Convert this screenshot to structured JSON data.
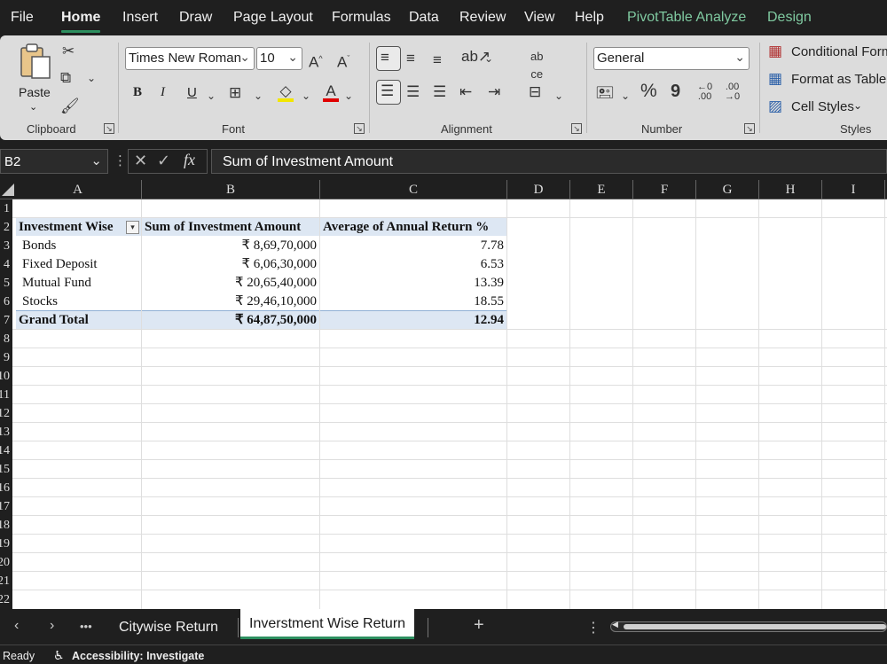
{
  "menu": {
    "items": [
      "File",
      "Home",
      "Insert",
      "Draw",
      "Page Layout",
      "Formulas",
      "Data",
      "Review",
      "View",
      "Help",
      "PivotTable Analyze",
      "Design"
    ],
    "active": "Home"
  },
  "ribbon": {
    "clipboard": {
      "paste_label": "Paste",
      "group_label": "Clipboard"
    },
    "font": {
      "font_name": "Times New Roman",
      "font_size": "10",
      "bold": "B",
      "italic": "I",
      "underline": "U",
      "group_label": "Font"
    },
    "alignment": {
      "group_label": "Alignment"
    },
    "number": {
      "format": "General",
      "percent": "%",
      "comma": "9",
      "group_label": "Number"
    },
    "styles": {
      "conditional_formatting": "Conditional Form",
      "format_as_table": "Format as Table",
      "cell_styles": "Cell Styles",
      "group_label": "Styles"
    }
  },
  "formula_bar": {
    "name_box": "B2",
    "formula": "Sum of  Investment Amount"
  },
  "columns": [
    "A",
    "B",
    "C",
    "D",
    "E",
    "F",
    "G",
    "H",
    "I"
  ],
  "rows": [
    "1",
    "2",
    "3",
    "4",
    "5",
    "6",
    "7",
    "8",
    "9",
    "10",
    "11",
    "12",
    "13",
    "14",
    "15",
    "16",
    "17",
    "18",
    "19",
    "20",
    "21",
    "22"
  ],
  "pivot": {
    "headers": [
      "Investment Wise",
      "Sum of  Investment Amount",
      "Average of  Annual Return %"
    ],
    "rows": [
      {
        "label": "Bonds",
        "amount": "₹ 8,69,70,000",
        "avg": "7.78"
      },
      {
        "label": "Fixed Deposit",
        "amount": "₹ 6,06,30,000",
        "avg": "6.53"
      },
      {
        "label": "Mutual Fund",
        "amount": "₹ 20,65,40,000",
        "avg": "13.39"
      },
      {
        "label": "Stocks",
        "amount": "₹ 29,46,10,000",
        "avg": "18.55"
      }
    ],
    "total": {
      "label": "Grand Total",
      "amount": "₹ 64,87,50,000",
      "avg": "12.94"
    }
  },
  "sheet_tabs": {
    "tab1": "Citywise Return",
    "tab2": "Inverstment Wise Return",
    "active": "Inverstment Wise Return"
  },
  "status": {
    "mode": "Ready",
    "accessibility": "Accessibility: Investigate"
  },
  "colors": {
    "accent": "#2d8f5f",
    "pivot_band": "#dde7f3",
    "pivot_tab_text": "#7fc9a0"
  }
}
